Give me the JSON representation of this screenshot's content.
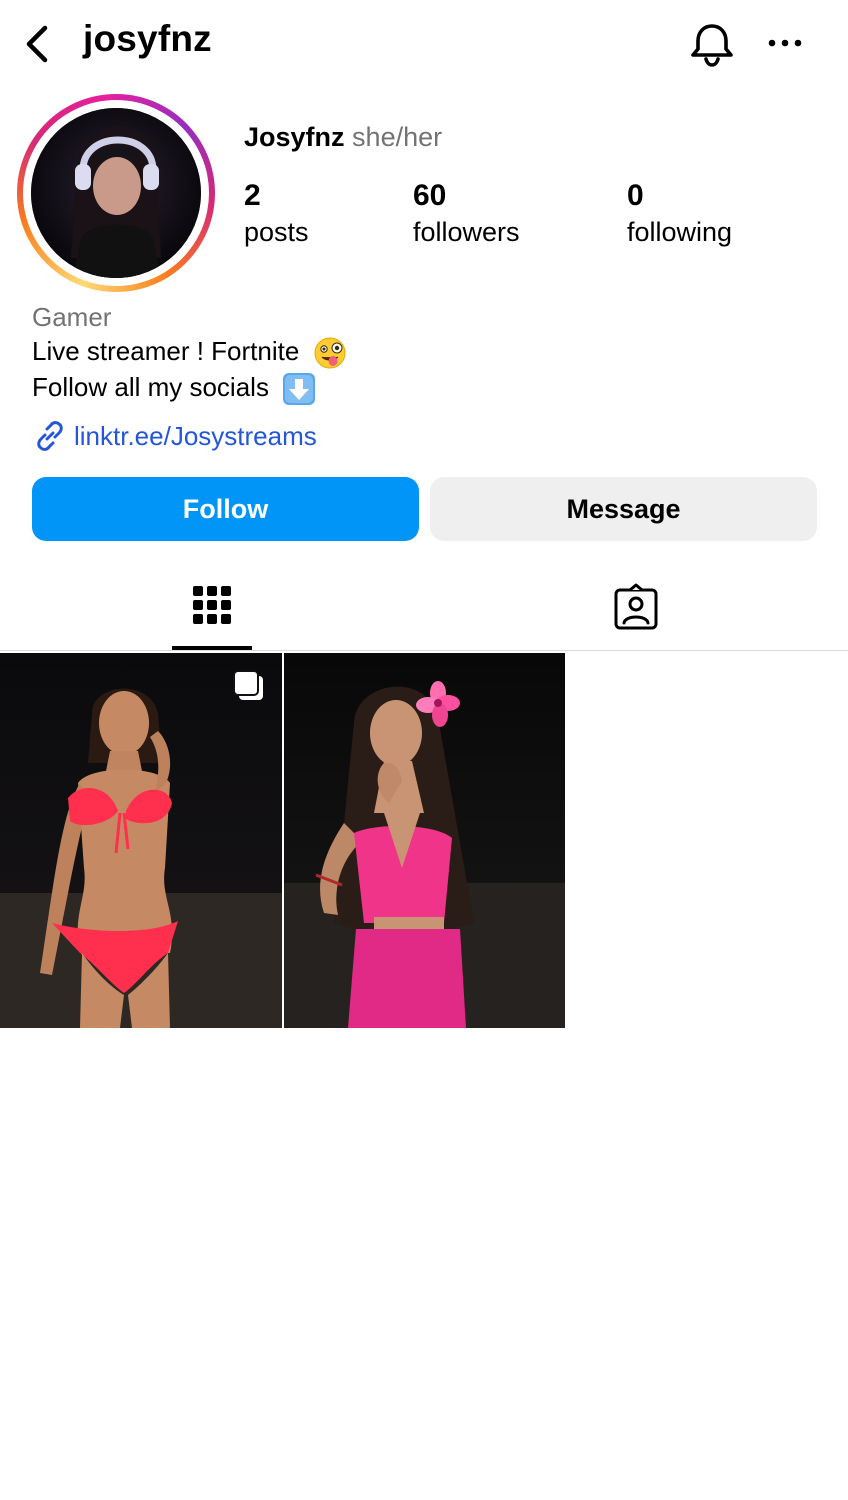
{
  "header": {
    "username": "josyfnz",
    "back_icon": "chevron-left-icon",
    "bell_icon": "bell-icon",
    "more_icon": "more-horizontal-icon"
  },
  "profile": {
    "display_name": "Josyfnz",
    "pronouns": "she/her",
    "stats": [
      {
        "value": "2",
        "label": "posts"
      },
      {
        "value": "60",
        "label": "followers"
      },
      {
        "value": "0",
        "label": "following"
      }
    ],
    "bio": {
      "category": "Gamer",
      "lines": [
        "Live streamer ! Fortnite",
        "Follow all my socials"
      ],
      "emojis": [
        "zany-face-emoji",
        "down-arrow-emoji"
      ],
      "link": "linktr.ee/Josystreams"
    }
  },
  "actions": {
    "follow_label": "Follow",
    "message_label": "Message"
  },
  "tabs": {
    "active": "grid",
    "items": [
      "grid-icon",
      "tagged-person-icon"
    ]
  },
  "posts": [
    {
      "type": "carousel",
      "description": "photo",
      "icon": "carousel-icon"
    },
    {
      "type": "single",
      "description": "photo"
    }
  ],
  "colors": {
    "accent": "#0095f6",
    "link": "#2456d8",
    "secondary_text": "#737373",
    "button_secondary_bg": "#efefef"
  }
}
